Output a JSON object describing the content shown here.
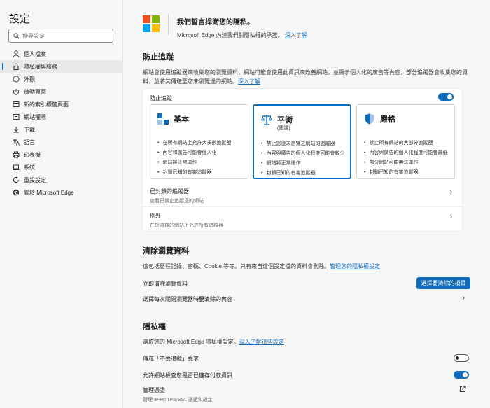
{
  "sidebar": {
    "title": "設定",
    "search_placeholder": "搜尋設定",
    "items": [
      {
        "label": "個人檔案",
        "icon": "person-icon"
      },
      {
        "label": "隱私權與服務",
        "icon": "lock-icon",
        "active": true
      },
      {
        "label": "外觀",
        "icon": "palette-icon"
      },
      {
        "label": "啟動頁面",
        "icon": "power-icon"
      },
      {
        "label": "新的索引標籤頁面",
        "icon": "new-tab-icon"
      },
      {
        "label": "網站權限",
        "icon": "site-permissions-icon"
      },
      {
        "label": "下載",
        "icon": "download-icon"
      },
      {
        "label": "語言",
        "icon": "language-icon"
      },
      {
        "label": "印表機",
        "icon": "printer-icon"
      },
      {
        "label": "系統",
        "icon": "computer-icon"
      },
      {
        "label": "重設設定",
        "icon": "reset-icon"
      },
      {
        "label": "關於 Microsoft Edge",
        "icon": "edge-icon"
      }
    ]
  },
  "banner": {
    "title": "我們誓言捍衛您的隱私。",
    "subtitle": "Microsoft Edge 內建我們對隱私權的承諾。",
    "link": "深入了解",
    "logo_colors": [
      "#f25022",
      "#7fba00",
      "#00a4ef",
      "#ffb900"
    ]
  },
  "tracking": {
    "title": "防止追蹤",
    "desc_line1": "網站會使用追蹤器來收集您的瀏覽資料，網站可能會使用此資訊來改善網站，並顯示個人化的廣告等內容，部分追蹤器會收集您的資",
    "desc_line2": "料，並將其傳送至您未瀏覽過的網站。",
    "desc_link": "深入了解",
    "toggle_label": "防止追蹤",
    "options": [
      {
        "title": "基本",
        "subtitle": "",
        "icon": "basic-icon",
        "bullets": [
          "在所有網站上允許大多數追蹤器",
          "內容和廣告可能會個人化",
          "網站將正常運作",
          "封鎖已知的有害追蹤器"
        ]
      },
      {
        "title": "平衡",
        "subtitle": "(建議)",
        "icon": "balance-scale-icon",
        "bullets": [
          "禁止您從未瀏覽之網站的追蹤器",
          "內容與廣告的個人化程度可能會較少",
          "網站將正常運作",
          "封鎖已知的有害追蹤器"
        ]
      },
      {
        "title": "嚴格",
        "subtitle": "",
        "icon": "shield-icon",
        "bullets": [
          "禁止所有網站的大部分追蹤器",
          "內容與廣告的個人化程度可能會最低",
          "部分網站可能無法運作",
          "封鎖已知的有害追蹤器"
        ]
      }
    ],
    "blocked_title": "已封鎖的追蹤器",
    "blocked_sub": "查看已禁止追蹤您的網站",
    "exceptions_title": "例外",
    "exceptions_sub": "在您選擇的網站上允許所有追蹤器"
  },
  "clear": {
    "title": "清除瀏覽資料",
    "desc": "這包括歷程記錄、密碼、Cookie 等等。只有來自這個設定檔的資料會刪除。",
    "desc_link": "管理您的隱私權設定",
    "now_label": "立即清除瀏覽資料",
    "button": "選擇要清除的項目",
    "on_close": "選擇每次關閉瀏覽器時要清除的內容"
  },
  "privacy": {
    "title": "隱私權",
    "desc": "選取您的 Microsoft Edge 隱私權設定。",
    "desc_link": "深入了解這些設定",
    "dnt": "傳送「不要追蹤」要求",
    "payment": "允許網站檢查您是否已儲存付款資訊",
    "certs_title": "管理憑證",
    "certs_sub": "管理 IP-HTTPS/SSL 憑證和設定"
  },
  "colors": {
    "accent": "#0f6cbd"
  }
}
